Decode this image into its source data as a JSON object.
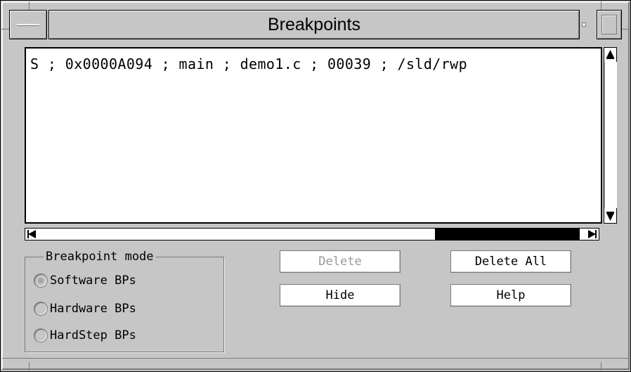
{
  "window": {
    "title": "Breakpoints"
  },
  "list": {
    "items": [
      "S ; 0x0000A094 ; main ; demo1.c ; 00039 ; /sld/rwp"
    ]
  },
  "mode_group": {
    "legend": "Breakpoint mode",
    "options": [
      {
        "label": "Software BPs",
        "selected": true,
        "enabled": false
      },
      {
        "label": "Hardware BPs",
        "selected": false,
        "enabled": true
      },
      {
        "label": "HardStep BPs",
        "selected": false,
        "enabled": true
      }
    ]
  },
  "buttons": {
    "delete": "Delete",
    "delete_all": "Delete All",
    "hide": "Hide",
    "help": "Help"
  },
  "icons": {
    "window_menu": "window-menu-icon",
    "minimize": "minimize-icon",
    "maximize": "maximize-icon",
    "scroll_up": "arrow-up-icon",
    "scroll_down": "arrow-down-icon",
    "scroll_left": "arrow-left-icon",
    "scroll_right": "arrow-right-icon"
  },
  "colors": {
    "window_bg": "#c6c6c6",
    "list_bg": "#ffffff",
    "thumb": "#000000"
  }
}
